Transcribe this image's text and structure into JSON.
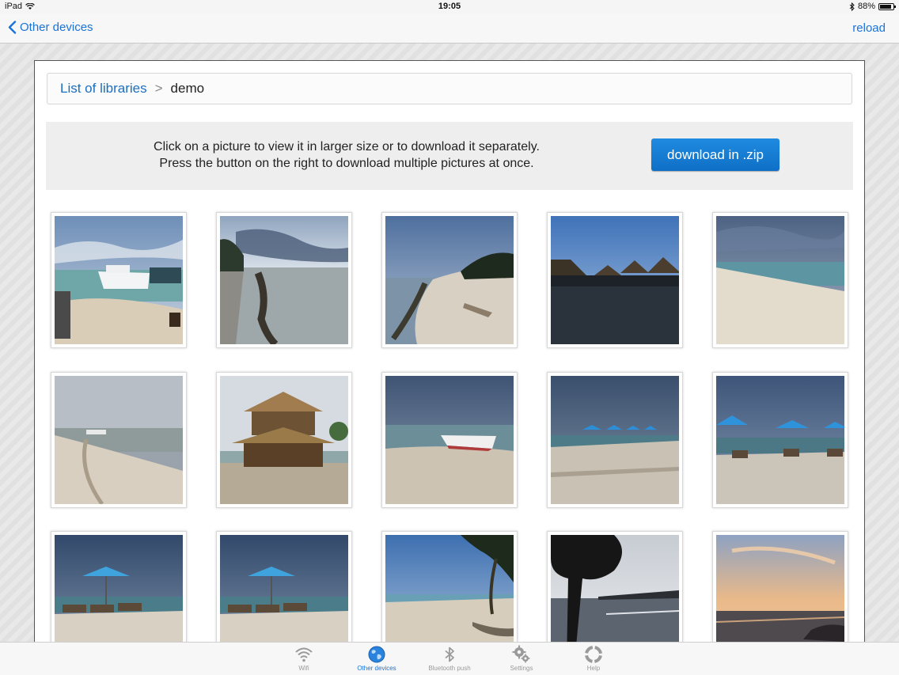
{
  "status_bar": {
    "device": "iPad",
    "time": "19:05",
    "battery": "88%",
    "battery_level": 0.88
  },
  "nav": {
    "back_label": "Other devices",
    "reload_label": "reload"
  },
  "breadcrumb": {
    "root_label": "List of libraries",
    "separator": ">",
    "current": "demo"
  },
  "info": {
    "line1": "Click on a picture to view it in larger size or to download it separately.",
    "line2": "Press the button on the right to download multiple pictures at once.",
    "button_label": "download in .zip"
  },
  "colors": {
    "accent": "#1a73d8",
    "button": "#1477cf"
  },
  "tabs": [
    {
      "label": "Wifi",
      "icon": "wifi-icon",
      "active": false
    },
    {
      "label": "Other devices",
      "icon": "globe-icon",
      "active": true
    },
    {
      "label": "Bluetooth push",
      "icon": "bluetooth-icon",
      "active": false
    },
    {
      "label": "Settings",
      "icon": "gear-icon",
      "active": false
    },
    {
      "label": "Help",
      "icon": "lifebuoy-icon",
      "active": false
    }
  ]
}
